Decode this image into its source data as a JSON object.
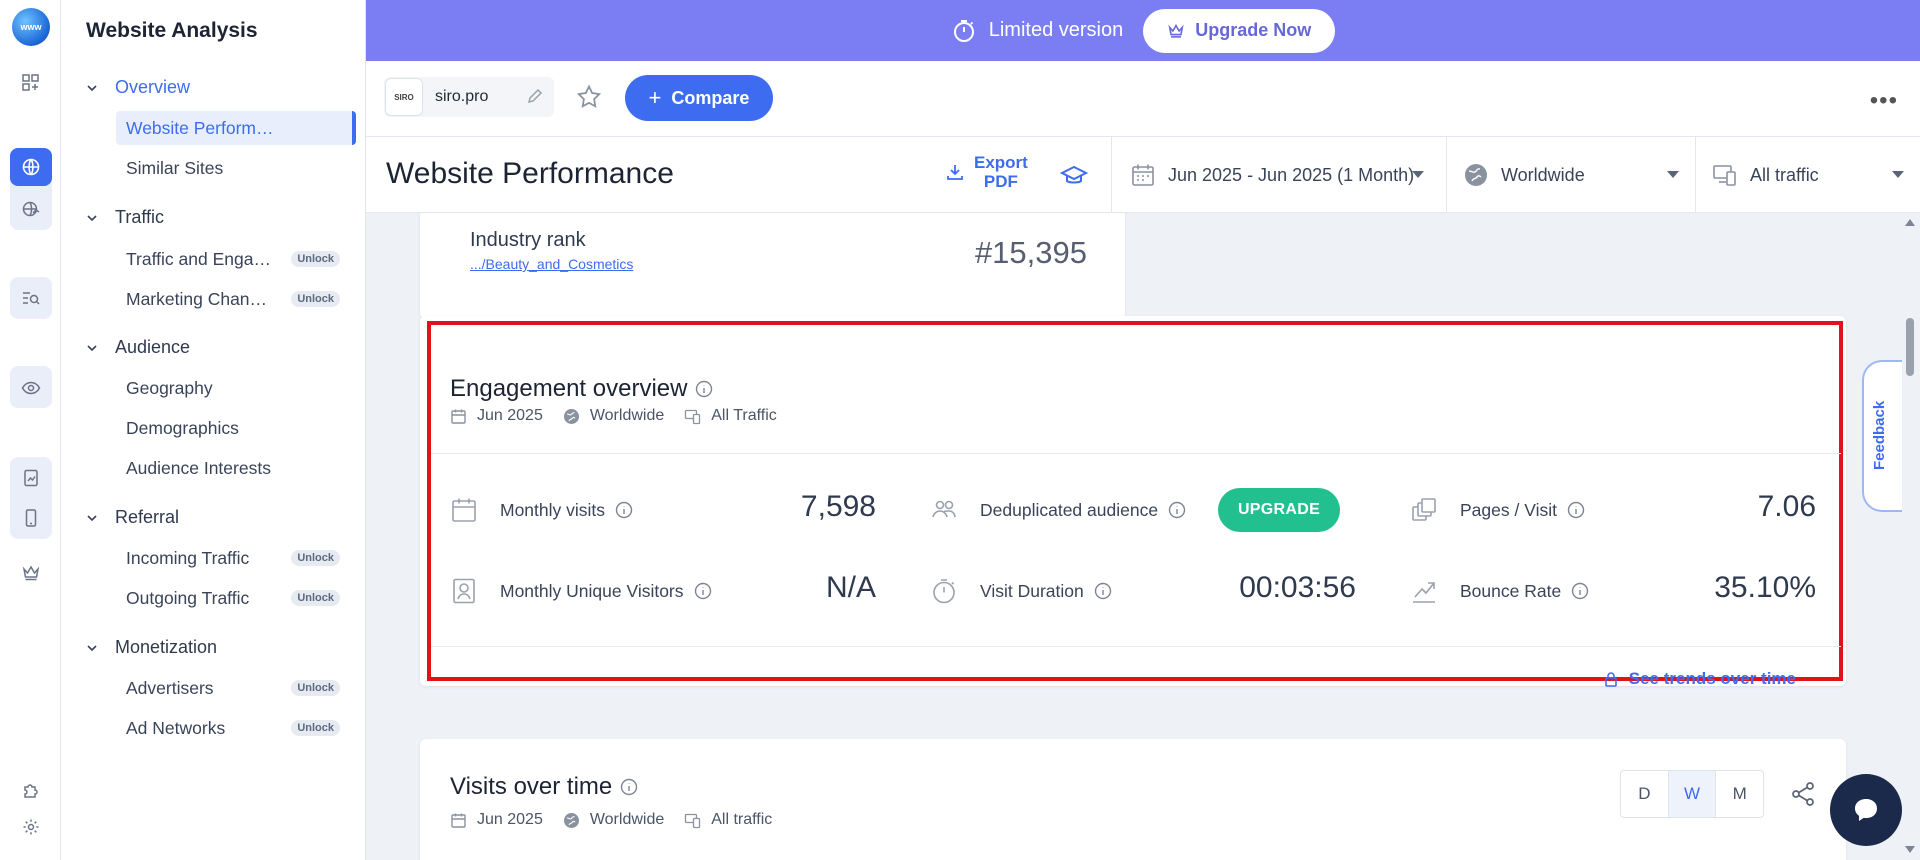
{
  "sidebar": {
    "title": "Website Analysis",
    "sections": [
      {
        "label": "Overview",
        "items": [
          {
            "label": "Website Performance",
            "locked": false,
            "active": true
          },
          {
            "label": "Similar Sites",
            "locked": false
          }
        ]
      },
      {
        "label": "Traffic",
        "items": [
          {
            "label": "Traffic and Engagement",
            "locked": true
          },
          {
            "label": "Marketing Channels",
            "locked": true
          }
        ]
      },
      {
        "label": "Audience",
        "items": [
          {
            "label": "Geography",
            "locked": false
          },
          {
            "label": "Demographics",
            "locked": false
          },
          {
            "label": "Audience Interests",
            "locked": false
          }
        ]
      },
      {
        "label": "Referral",
        "items": [
          {
            "label": "Incoming Traffic",
            "locked": true
          },
          {
            "label": "Outgoing Traffic",
            "locked": true
          }
        ]
      },
      {
        "label": "Monetization",
        "items": [
          {
            "label": "Advertisers",
            "locked": true
          },
          {
            "label": "Ad Networks",
            "locked": true
          }
        ]
      }
    ],
    "unlock_label": "Unlock"
  },
  "banner": {
    "limited_label": "Limited version",
    "upgrade_label": "Upgrade Now"
  },
  "sitebar": {
    "favicon_text": "SIRO",
    "site_name": "siro.pro",
    "compare_label": "Compare",
    "more_label": "•••"
  },
  "header": {
    "page_title": "Website Performance",
    "export_line1": "Export",
    "export_line2": "PDF",
    "date_range": "Jun 2025 - Jun 2025 (1 Month)",
    "region": "Worldwide",
    "traffic": "All traffic"
  },
  "industry_rank": {
    "label": "Industry rank",
    "category_link": ".../Beauty_and_Cosmetics",
    "value": "#15,395"
  },
  "engagement": {
    "title": "Engagement overview",
    "meta": {
      "date": "Jun 2025",
      "region": "Worldwide",
      "traffic": "All Traffic"
    },
    "metrics": {
      "monthly_visits": {
        "label": "Monthly visits",
        "value": "7,598"
      },
      "dedup_audience": {
        "label": "Deduplicated audience",
        "button": "UPGRADE"
      },
      "pages_per_visit": {
        "label": "Pages / Visit",
        "value": "7.06"
      },
      "unique_visitors": {
        "label": "Monthly Unique Visitors",
        "value": "N/A"
      },
      "visit_duration": {
        "label": "Visit Duration",
        "value": "00:03:56"
      },
      "bounce_rate": {
        "label": "Bounce Rate",
        "value": "35.10%"
      }
    },
    "trends_link": "See trends over time"
  },
  "visits_over_time": {
    "title": "Visits over time",
    "meta": {
      "date": "Jun 2025",
      "region": "Worldwide",
      "traffic": "All traffic"
    },
    "granularity": [
      "D",
      "W",
      "M"
    ],
    "selected": "W"
  },
  "feedback_label": "Feedback",
  "colors": {
    "accent": "#3e6cf0",
    "banner": "#7b7ef2",
    "upgrade": "#22c08f",
    "highlight": "#e0121b"
  }
}
